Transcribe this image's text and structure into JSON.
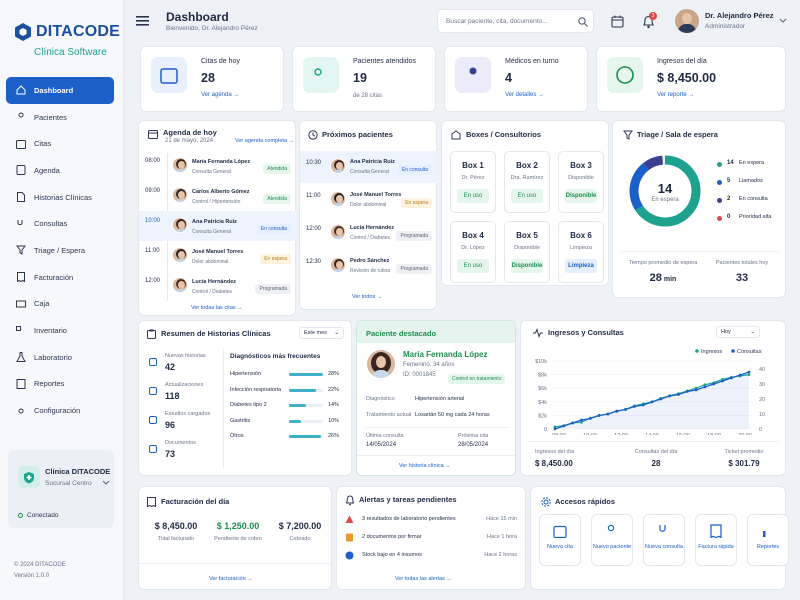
{
  "brand": {
    "name": "DITACODE",
    "sub": "Clínica Software"
  },
  "nav": [
    "Dashboard",
    "Pacientes",
    "Citas",
    "Agenda",
    "Historias Clínicas",
    "Consultas",
    "Triage / Espera",
    "Facturación",
    "Caja",
    "Inventario",
    "Laboratorio",
    "Reportes",
    "Configuración"
  ],
  "clinic": {
    "name": "Clínica DITACODE",
    "branch": "Sucursal Centro",
    "status": "Conectado"
  },
  "footer": {
    "copy": "© 2024 DITACODE",
    "version": "Versión 1.0.0"
  },
  "header": {
    "title": "Dashboard",
    "welcome": "Bienvenido, Dr. Alejandro Pérez",
    "search_placeholder": "Buscar paciente, cita, documento...",
    "notif_count": "3",
    "user_name": "Dr. Alejandro Pérez",
    "user_role": "Administrador"
  },
  "kpis": [
    {
      "label": "Citas de hoy",
      "value": "28",
      "link": "Ver agenda",
      "color": "#1b5fc9",
      "bg": "#e8f0fd",
      "icon": "calendar-icon"
    },
    {
      "label": "Pacientes atendidos",
      "value": "19",
      "sub": "de 28 citas",
      "color": "#1ea28f",
      "bg": "#e4f6f1",
      "icon": "users-icon"
    },
    {
      "label": "Médicos en turno",
      "value": "4",
      "link": "Ver detalles",
      "color": "#3a3f8f",
      "bg": "#ecebfa",
      "icon": "doctor-icon"
    },
    {
      "label": "Ingresos del día",
      "value": "$ 8,450.00",
      "link": "Ver reporte",
      "color": "#1e8e4f",
      "bg": "#e5f6ec",
      "icon": "dollar-icon"
    }
  ],
  "agenda": {
    "title": "Agenda de hoy",
    "date": "21 de mayo, 2024",
    "link": "Ver agenda completa",
    "footer": "Ver todas las citas",
    "items": [
      {
        "time": "08:00",
        "name": "María Fernanda López",
        "type": "Consulta General",
        "status": "Atendida",
        "badge": "green"
      },
      {
        "time": "09:00",
        "name": "Carlos Alberto Gómez",
        "type": "Control / Hipertensión",
        "status": "Atendida",
        "badge": "green"
      },
      {
        "time": "10:00",
        "name": "Ana Patricia Ruiz",
        "type": "Consulta General",
        "status": "En consulta",
        "badge": "blue"
      },
      {
        "time": "11:00",
        "name": "José Manuel Torres",
        "type": "Dolor abdominal",
        "status": "En espera",
        "badge": "yellow"
      },
      {
        "time": "12:00",
        "name": "Lucía Hernández",
        "type": "Control / Diabetes",
        "status": "Programada",
        "badge": "gray"
      }
    ]
  },
  "next": {
    "title": "Próximos pacientes",
    "footer": "Ver todos",
    "items": [
      {
        "time": "10:30",
        "name": "Ana Patricia Ruiz",
        "type": "Consulta General",
        "status": "En consulta",
        "badge": "blue"
      },
      {
        "time": "11:00",
        "name": "José Manuel Torres",
        "type": "Dolor abdominal",
        "status": "En espera",
        "badge": "yellow"
      },
      {
        "time": "12:00",
        "name": "Lucía Hernández",
        "type": "Control / Diabetes",
        "status": "Programada",
        "badge": "gray"
      },
      {
        "time": "12:30",
        "name": "Pedro Sánchez",
        "type": "Revisión de rutina",
        "status": "Programada",
        "badge": "gray"
      }
    ]
  },
  "boxes": {
    "title": "Boxes / Consultorios",
    "items": [
      {
        "name": "Box 1",
        "sub": "Dr. Pérez",
        "status": "En uso",
        "kind": "use"
      },
      {
        "name": "Box 2",
        "sub": "Dra. Ramírez",
        "status": "En uso",
        "kind": "use"
      },
      {
        "name": "Box 3",
        "sub": "Disponible",
        "status": "Disponible",
        "kind": "free"
      },
      {
        "name": "Box 4",
        "sub": "Dr. López",
        "status": "En uso",
        "kind": "use"
      },
      {
        "name": "Box 5",
        "sub": "Disponible",
        "status": "Disponible",
        "kind": "free"
      },
      {
        "name": "Box 6",
        "sub": "Limpieza",
        "status": "Limpieza",
        "kind": "clean"
      }
    ]
  },
  "triage": {
    "title": "Triage / Sala de espera",
    "center_value": "14",
    "center_label": "En espera",
    "legend": [
      {
        "value": "14",
        "label": "En espera",
        "color": "#1ea28f"
      },
      {
        "value": "5",
        "label": "Llamados",
        "color": "#1b5fc9"
      },
      {
        "value": "2",
        "label": "En consulta",
        "color": "#3a3f8f"
      },
      {
        "value": "0",
        "label": "Prioridad alta",
        "color": "#e04a4a"
      }
    ],
    "wait_label": "Tiempo promedio de espera",
    "wait_value": "28",
    "wait_unit": "min",
    "total_label": "Pacientes totales hoy",
    "total_value": "33"
  },
  "historias": {
    "title": "Resumen de Historias Clínicas",
    "filter": "Este mes",
    "stats": [
      {
        "label": "Nuevas historias",
        "value": "42"
      },
      {
        "label": "Actualizaciones",
        "value": "118"
      },
      {
        "label": "Estudios cargados",
        "value": "96"
      },
      {
        "label": "Documentos",
        "value": "73"
      }
    ],
    "diag_title": "Diagnósticos más frecuentes",
    "diags": [
      {
        "name": "Hipertensión",
        "pct": "28%",
        "v": 28
      },
      {
        "name": "Infección respiratoria",
        "pct": "22%",
        "v": 22
      },
      {
        "name": "Diabetes tipo 2",
        "pct": "14%",
        "v": 14
      },
      {
        "name": "Gastritis",
        "pct": "10%",
        "v": 10
      },
      {
        "name": "Otros",
        "pct": "26%",
        "v": 26
      }
    ]
  },
  "featured": {
    "title": "Paciente destacado",
    "name": "María Fernanda López",
    "info": "Femenino, 34 años",
    "id": "ID: 0001845",
    "status": "Control en tratamiento",
    "diag_label": "Diagnóstico",
    "diag": "Hipertensión arterial",
    "tx_label": "Tratamiento actual",
    "tx": "Losartán 50 mg cada 24 horas",
    "last_label": "Última consulta",
    "last": "14/05/2024",
    "next_label": "Próxima cita",
    "next": "28/05/2024",
    "link": "Ver historia clínica"
  },
  "chart": {
    "title": "Ingresos y Consultas",
    "filter": "Hoy",
    "stats": [
      {
        "label": "Ingresos del día",
        "value": "$ 8,450.00"
      },
      {
        "label": "Consultas del día",
        "value": "28"
      },
      {
        "label": "Ticket promedio",
        "value": "$ 301.79"
      }
    ]
  },
  "chart_data": {
    "type": "line",
    "x": [
      "08:00",
      "10:00",
      "12:00",
      "14:00",
      "16:00",
      "18:00",
      "20:00"
    ],
    "series": [
      {
        "name": "Ingresos",
        "color": "#1ea28f",
        "axis": "left",
        "values": [
          0.3,
          0.5,
          0.9,
          1.0,
          1.6,
          2.0,
          2.2,
          2.6,
          2.9,
          3.4,
          3.7,
          4.0,
          4.5,
          4.9,
          5.2,
          5.6,
          6.0,
          6.5,
          6.8,
          7.3,
          7.6,
          7.8,
          8.0
        ]
      },
      {
        "name": "Consultas",
        "color": "#1b5fc9",
        "axis": "right",
        "values": [
          0,
          2,
          4,
          6,
          7,
          9,
          10,
          12,
          13,
          15,
          16,
          18,
          20,
          22,
          23,
          25,
          26,
          28,
          30,
          32,
          34,
          36,
          38
        ]
      }
    ],
    "yleft": {
      "ticks": [
        "$10k",
        "$8k",
        "$6k",
        "$4k",
        "$2k",
        "0"
      ],
      "range": [
        0,
        10
      ]
    },
    "yright": {
      "ticks": [
        "40",
        "30",
        "20",
        "10",
        "0"
      ],
      "range": [
        0,
        40
      ]
    }
  },
  "billing": {
    "title": "Facturación del día",
    "items": [
      {
        "value": "$ 8,450.00",
        "label": "Total facturado",
        "color": "#1f2a44"
      },
      {
        "value": "$ 1,250.00",
        "label": "Pendiente de cobro",
        "color": "#1e8e4f"
      },
      {
        "value": "$ 7,200.00",
        "label": "Cobrado",
        "color": "#1f2a44"
      }
    ],
    "link": "Ver facturación"
  },
  "alerts": {
    "title": "Alertas y tareas pendientes",
    "items": [
      {
        "text": "3 resultados de laboratorio pendientes",
        "time": "Hace 15 min",
        "icon": "warning-icon",
        "color": "#e04a4a"
      },
      {
        "text": "2 documentos por firmar",
        "time": "Hace 1 hora",
        "icon": "document-icon",
        "color": "#e89a2c"
      },
      {
        "text": "Stock bajo en 4 insumos",
        "time": "Hace 2 horas",
        "icon": "info-icon",
        "color": "#1b5fc9"
      }
    ],
    "link": "Ver todas las alertas"
  },
  "quick": {
    "title": "Accesos rápidos",
    "items": [
      {
        "label": "Nueva cita",
        "icon": "calendar-plus-icon"
      },
      {
        "label": "Nuevo paciente",
        "icon": "user-plus-icon"
      },
      {
        "label": "Nueva consulta",
        "icon": "stethoscope-icon"
      },
      {
        "label": "Factura rápida",
        "icon": "invoice-icon"
      },
      {
        "label": "Reportes",
        "icon": "bar-chart-icon"
      }
    ]
  }
}
